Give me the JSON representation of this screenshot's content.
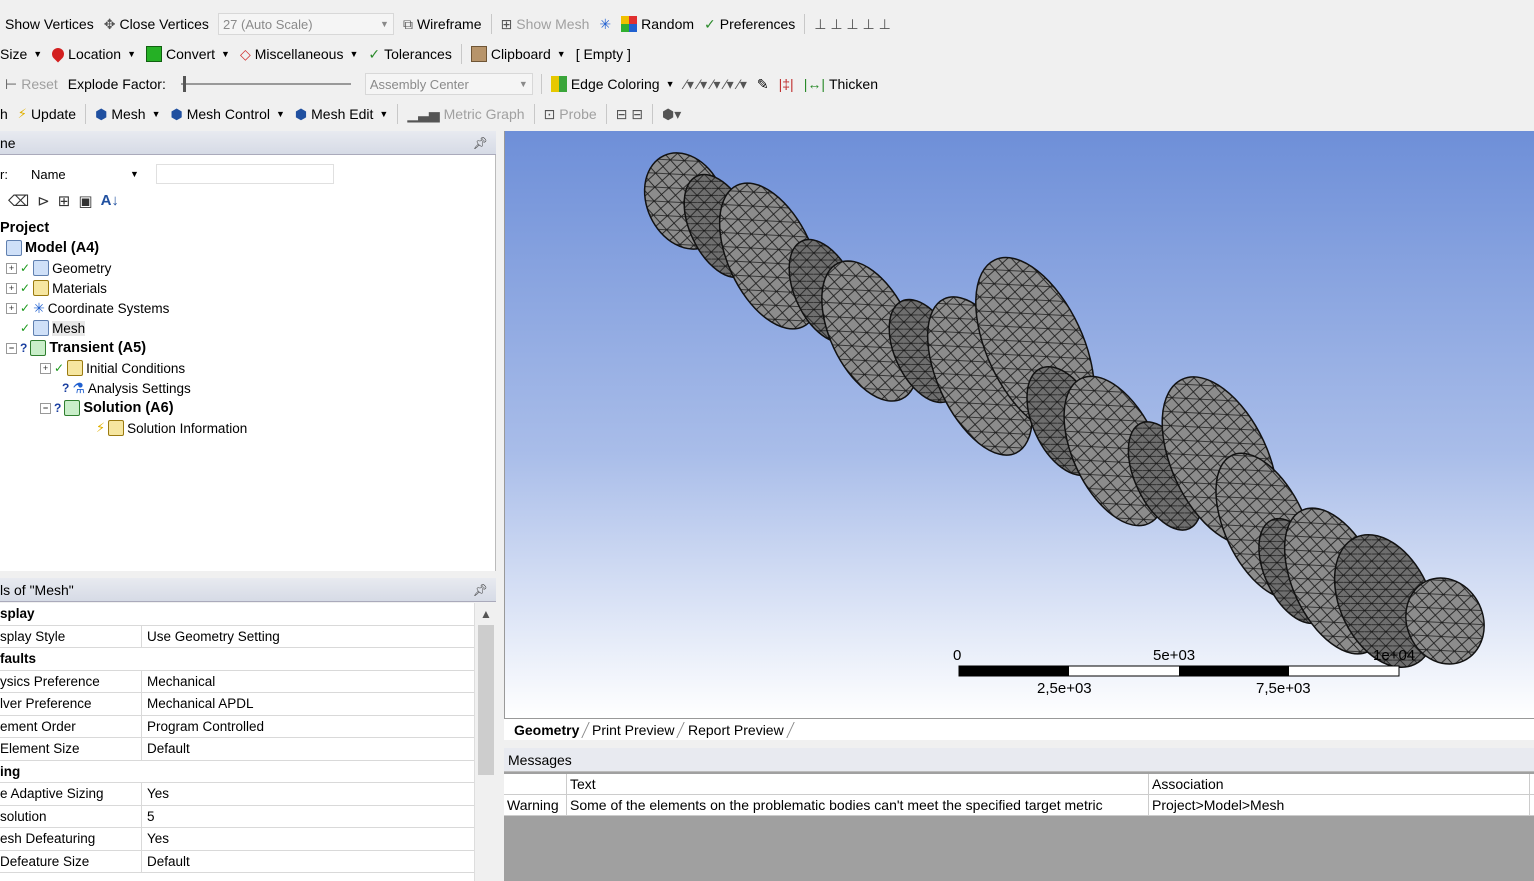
{
  "toolbar1": {
    "show_vertices": "Show Vertices",
    "close_vertices": "Close Vertices",
    "scale": "27 (Auto Scale)",
    "wireframe": "Wireframe",
    "show_mesh": "Show Mesh",
    "random": "Random",
    "preferences": "Preferences"
  },
  "toolbar2": {
    "size": "Size",
    "location": "Location",
    "convert": "Convert",
    "miscellaneous": "Miscellaneous",
    "tolerances": "Tolerances",
    "clipboard": "Clipboard",
    "empty": "[ Empty ]"
  },
  "toolbar3": {
    "reset": "Reset",
    "explode_factor": "Explode Factor:",
    "assembly_center": "Assembly Center",
    "edge_coloring": "Edge Coloring",
    "thicken": "Thicken"
  },
  "toolbar4": {
    "update": "Update",
    "mesh": "Mesh",
    "mesh_control": "Mesh Control",
    "mesh_edit": "Mesh Edit",
    "metric_graph": "Metric Graph",
    "probe": "Probe"
  },
  "outline": {
    "title": "ne",
    "filter_label": "r:",
    "filter_value": "Name",
    "tree": {
      "project": "Project",
      "model": "Model (A4)",
      "geometry": "Geometry",
      "materials": "Materials",
      "coord_systems": "Coordinate Systems",
      "mesh": "Mesh",
      "transient": "Transient (A5)",
      "initial_conditions": "Initial Conditions",
      "analysis_settings": "Analysis Settings",
      "solution": "Solution (A6)",
      "solution_information": "Solution Information"
    }
  },
  "details": {
    "title": "ls of \"Mesh\"",
    "rows": [
      {
        "k": "splay",
        "v": "",
        "cat": true
      },
      {
        "k": "splay Style",
        "v": "Use Geometry Setting"
      },
      {
        "k": "faults",
        "v": "",
        "cat": true
      },
      {
        "k": "ysics Preference",
        "v": "Mechanical"
      },
      {
        "k": "lver Preference",
        "v": "Mechanical APDL"
      },
      {
        "k": "ement Order",
        "v": "Program Controlled"
      },
      {
        "k": " Element Size",
        "v": "Default"
      },
      {
        "k": "ing",
        "v": "",
        "cat": true
      },
      {
        "k": "e Adaptive Sizing",
        "v": "Yes"
      },
      {
        "k": "solution",
        "v": "5"
      },
      {
        "k": "esh Defeaturing",
        "v": "Yes"
      },
      {
        "k": " Defeature Size",
        "v": "Default"
      }
    ]
  },
  "viewport": {
    "scale": {
      "zero": "0",
      "mid": "5e+03",
      "end": "1e+04",
      "q1": "2,5e+03",
      "q3": "7,5e+03"
    }
  },
  "tabs": [
    "Geometry",
    "Print Preview",
    "Report Preview"
  ],
  "messages": {
    "title": "Messages",
    "headers": [
      "",
      "Text",
      "Association"
    ],
    "rows": [
      [
        "Warning",
        "Some of the elements on the problematic bodies can't meet the specified target metric",
        "Project>Model>Mesh"
      ]
    ]
  }
}
